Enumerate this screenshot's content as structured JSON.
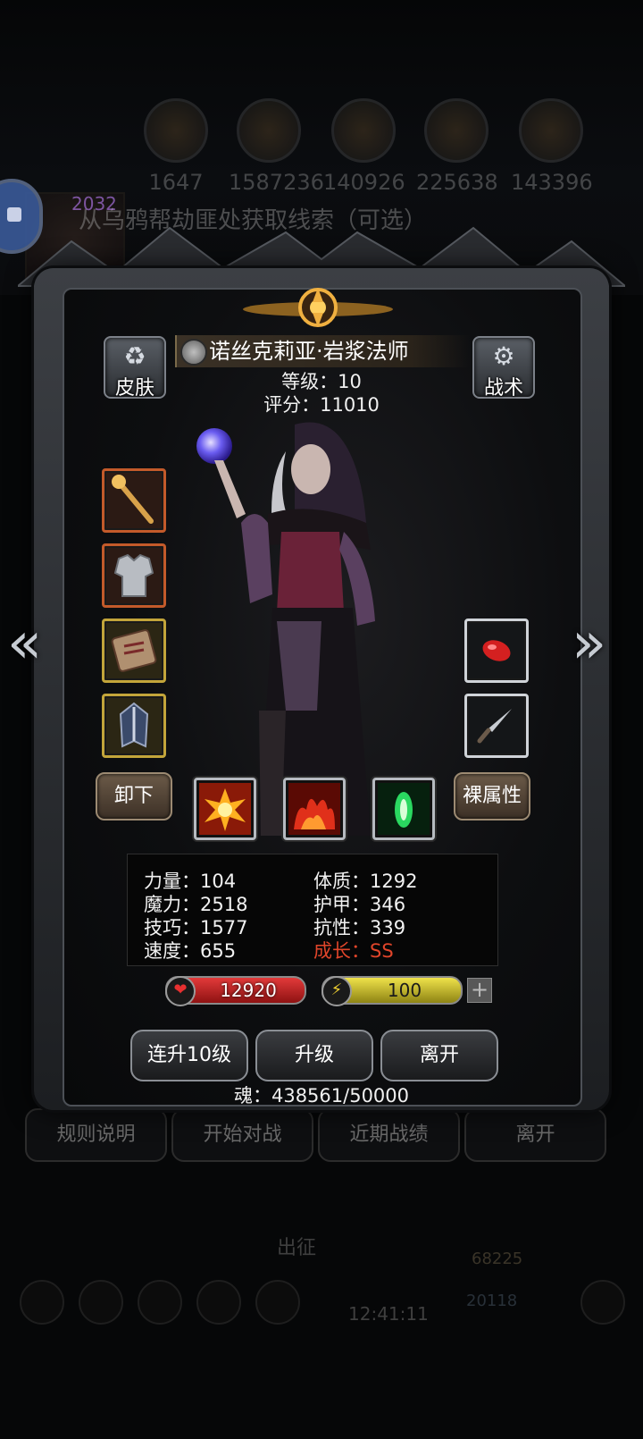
{
  "background": {
    "resources": [
      "1647",
      "1587236",
      "140926",
      "225638",
      "143396"
    ],
    "gem_value": "2032",
    "quest_text": "从乌鸦帮劫匪处获取线索（可选）",
    "bottom_buttons": [
      "规则说明",
      "开始对战",
      "近期战绩",
      "离开"
    ],
    "sortie_label": "出征",
    "clock": "12:41:11",
    "coin_value": "68225",
    "gem_value_2": "20118"
  },
  "character": {
    "name": "诺丝克莉亚·岩浆法师",
    "level_text": "等级：10",
    "score_text": "评分：11010",
    "skin_button": "皮肤",
    "tactics_button": "战术",
    "unequip_button": "卸下",
    "base_attr_button": "裸属性"
  },
  "equipment_left": [
    {
      "icon": "staff-icon",
      "rarity": "red"
    },
    {
      "icon": "armor-icon",
      "rarity": "red"
    },
    {
      "icon": "scroll-icon",
      "rarity": "gold"
    },
    {
      "icon": "cloak-icon",
      "rarity": "gold"
    }
  ],
  "equipment_right": [
    {
      "icon": "red-gem-icon",
      "rarity": "white"
    },
    {
      "icon": "dagger-icon",
      "rarity": "white"
    }
  ],
  "skills": [
    "fire-burst-icon",
    "flame-wave-icon",
    "green-crystal-icon"
  ],
  "stats": {
    "strength": "力量：104",
    "magic": "魔力：2518",
    "skill": "技巧：1577",
    "speed": "速度：655",
    "constitution": "体质：1292",
    "armor": "护甲：346",
    "resistance": "抗性：339",
    "growth": "成长：SS"
  },
  "bars": {
    "hp": "12920",
    "energy": "100",
    "plus": "+"
  },
  "actions": {
    "level10": "连升10级",
    "levelup": "升级",
    "leave": "离开"
  },
  "soul_text": "魂：438561/50000",
  "colors": {
    "growth": "#e0452a",
    "hp": "#d42a2a",
    "energy": "#e0d43a"
  }
}
